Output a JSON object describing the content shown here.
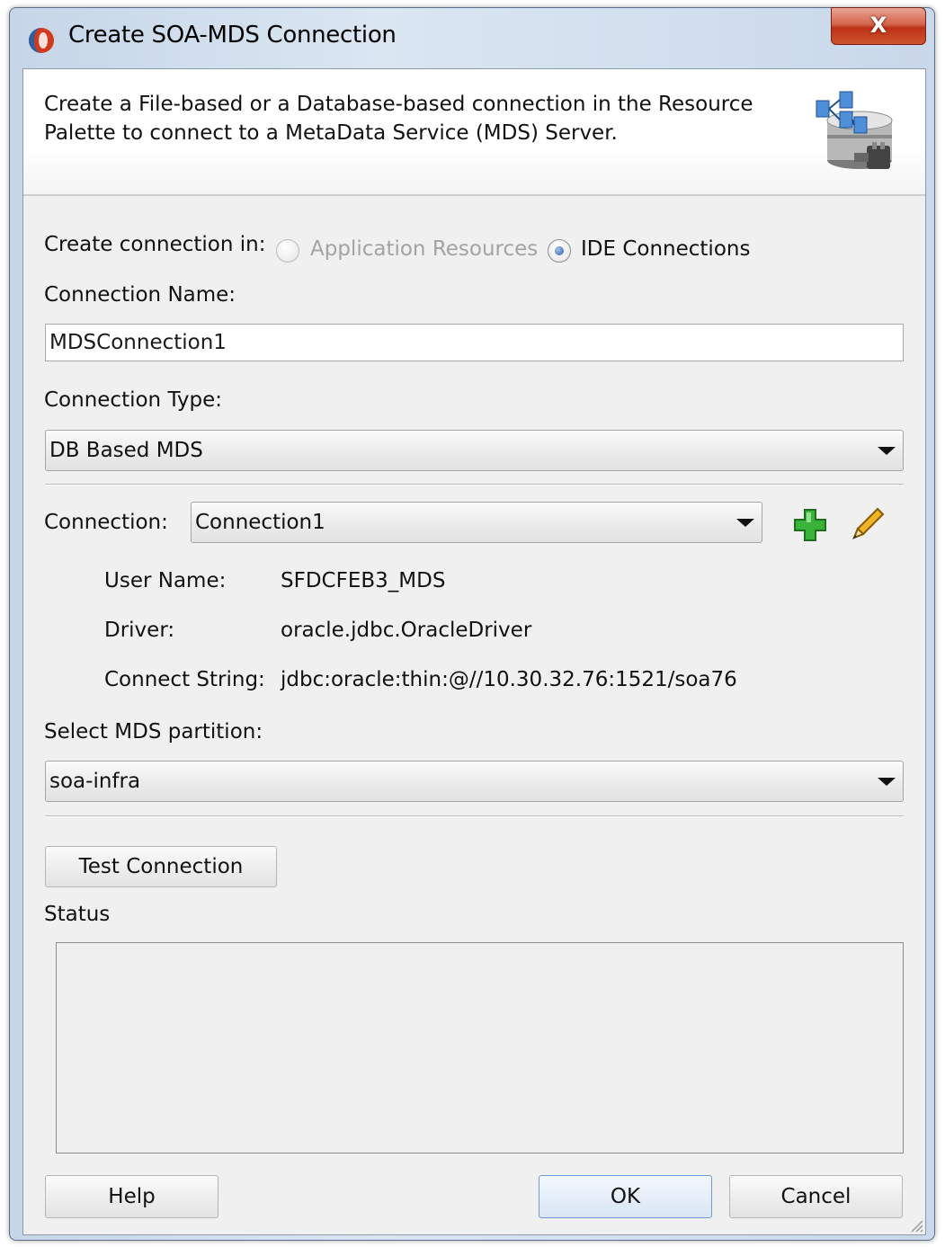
{
  "window": {
    "title": "Create SOA-MDS Connection",
    "close_label": "X"
  },
  "header": {
    "description": "Create a File-based or a Database-based connection in the Resource Palette to connect to a MetaData Service (MDS) Server."
  },
  "create_in": {
    "label": "Create connection in:",
    "options": [
      {
        "label": "Application Resources",
        "selected": false,
        "enabled": false
      },
      {
        "label": "IDE Connections",
        "selected": true,
        "enabled": true
      }
    ]
  },
  "connection_name": {
    "label": "Connection Name:",
    "value": "MDSConnection1"
  },
  "connection_type": {
    "label": "Connection Type:",
    "value": "DB Based MDS"
  },
  "connection": {
    "label": "Connection:",
    "value": "Connection1",
    "add_icon": "plus-icon",
    "edit_icon": "pencil-icon"
  },
  "details": {
    "user_name_label": "User Name:",
    "user_name_value": "SFDCFEB3_MDS",
    "driver_label": "Driver:",
    "driver_value": "oracle.jdbc.OracleDriver",
    "connect_string_label": "Connect String:",
    "connect_string_value": "jdbc:oracle:thin:@//10.30.32.76:1521/soa76"
  },
  "partition": {
    "label": "Select MDS partition:",
    "value": "soa-infra"
  },
  "test_connection_label": "Test Connection",
  "status": {
    "label": "Status",
    "text": ""
  },
  "footer": {
    "help_label": "Help",
    "ok_label": "OK",
    "cancel_label": "Cancel"
  },
  "colors": {
    "plus_icon": "#2ea02e",
    "pencil_icon": "#e0a020",
    "close_button": "#c9442a"
  }
}
